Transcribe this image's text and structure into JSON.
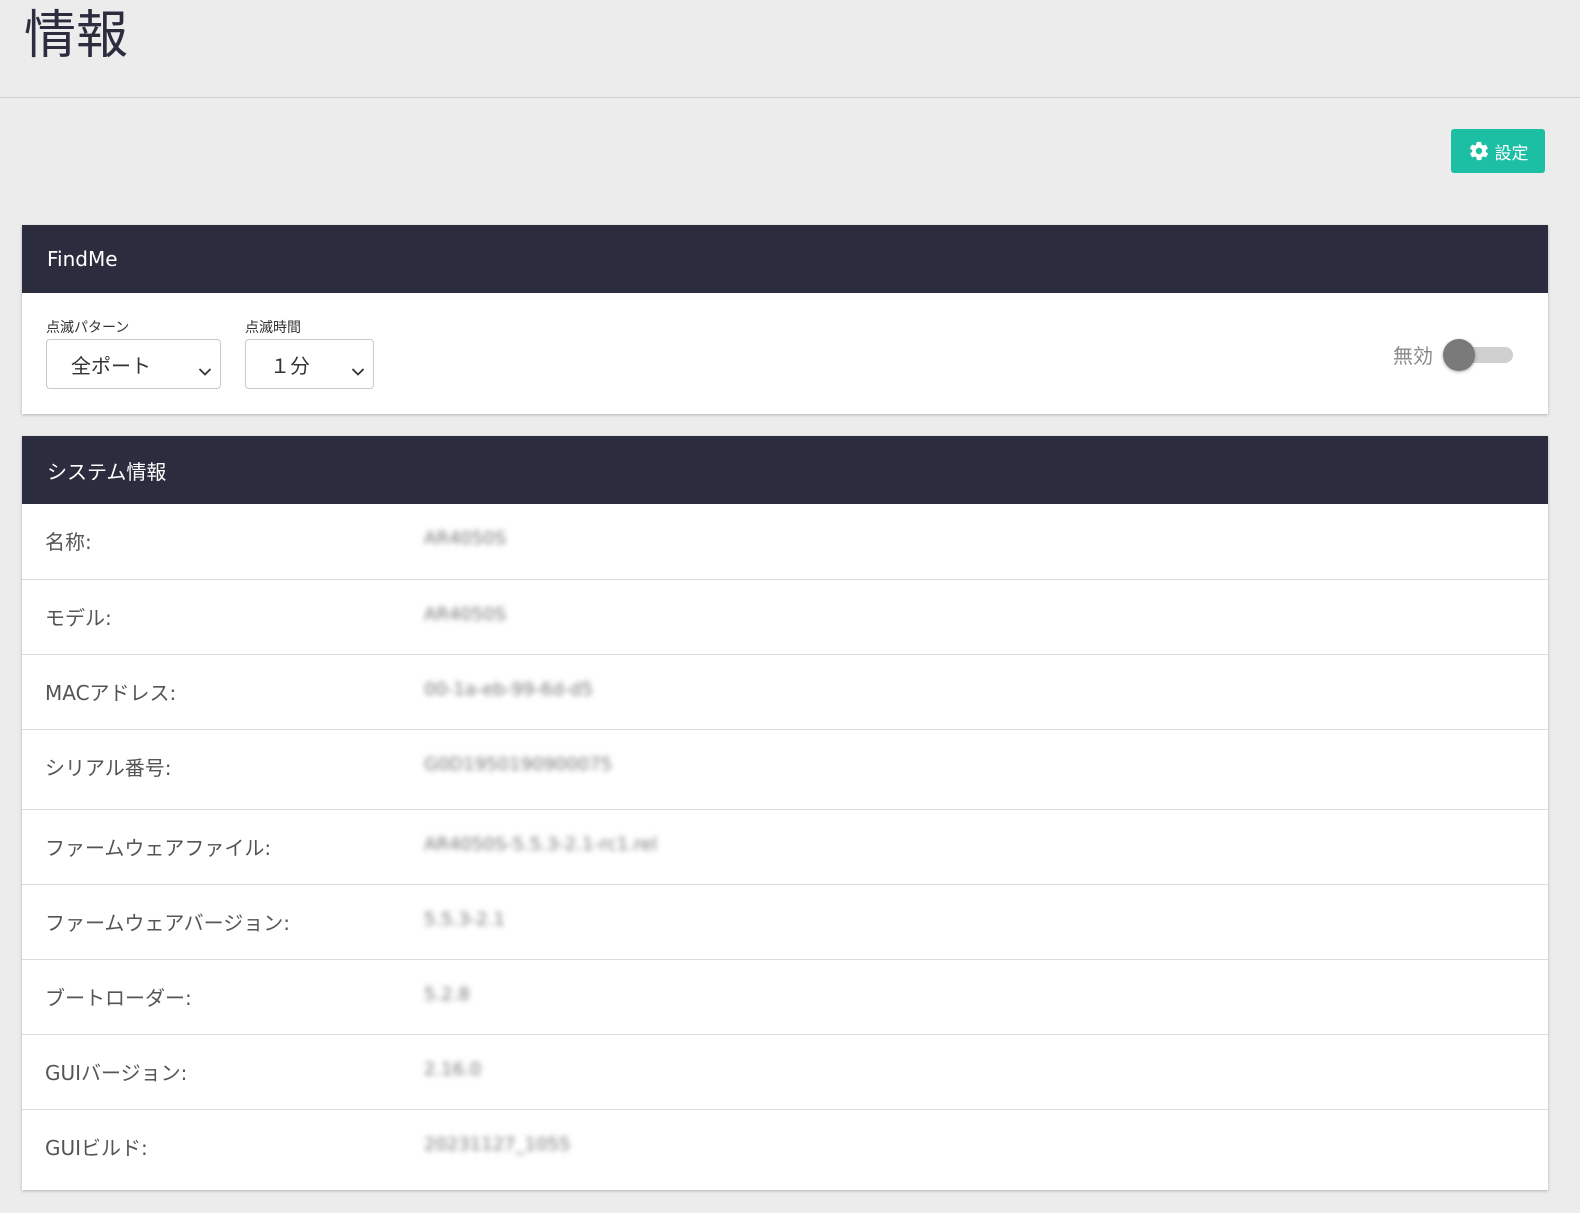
{
  "page": {
    "title": "情報"
  },
  "toolbar": {
    "settings_label": "設定",
    "settings_icon": "gear-icon"
  },
  "findme": {
    "title": "FindMe",
    "pattern": {
      "label": "点滅パターン",
      "value": "全ポート"
    },
    "duration": {
      "label": "点滅時間",
      "value": "１分"
    },
    "toggle": {
      "label": "無効",
      "enabled": false
    }
  },
  "system_info": {
    "title": "システム情報",
    "rows": [
      {
        "label": "名称:",
        "value": "AR4050S"
      },
      {
        "label": "モデル:",
        "value": "AR4050S"
      },
      {
        "label": "MACアドレス:",
        "value": "00-1a-eb-99-6d-d5"
      },
      {
        "label": "シリアル番号:",
        "value": "G0D1950190900075"
      },
      {
        "label": "ファームウェアファイル:",
        "value": "AR4050S-5.5.3-2.1-rc1.rel"
      },
      {
        "label": "ファームウェアバージョン:",
        "value": "5.5.3-2.1"
      },
      {
        "label": "ブートローダー:",
        "value": "5.2.8"
      },
      {
        "label": "GUIバージョン:",
        "value": "2.16.0"
      },
      {
        "label": "GUIビルド:",
        "value": "20231127_1055"
      }
    ]
  },
  "colors": {
    "header_bg": "#2b2d3e",
    "accent": "#1cbfa4",
    "page_bg": "#ececec"
  }
}
